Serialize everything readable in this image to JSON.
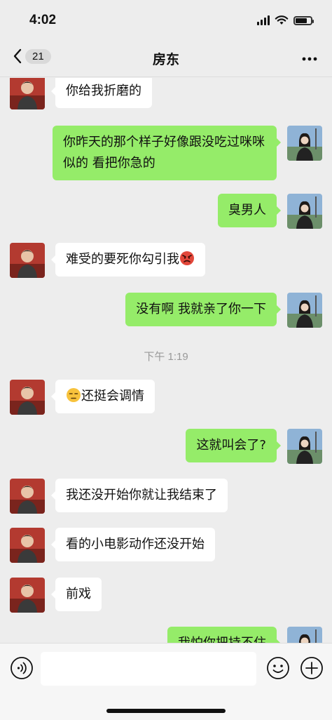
{
  "status_bar": {
    "time": "4:02"
  },
  "header": {
    "back_badge": "21",
    "title": "房东",
    "more_icon": "more-dots-icon"
  },
  "messages": [
    {
      "side": "left",
      "text": "你给我折磨的"
    },
    {
      "side": "right",
      "text": "你昨天的那个样子好像跟没吃过咪咪似的 看把你急的"
    },
    {
      "side": "right",
      "text": "臭男人"
    },
    {
      "side": "left",
      "text": "难受的要死你勾引我",
      "emoji": "angry-face"
    },
    {
      "side": "right",
      "text": "没有啊 我就亲了你一下"
    },
    {
      "side": "left",
      "text": "还挺会调情",
      "emoji_before": "unamused-face"
    },
    {
      "side": "right",
      "text": "这就叫会了?"
    },
    {
      "side": "left",
      "text": "我还没开始你就让我结束了"
    },
    {
      "side": "left",
      "text": "看的小电影动作还没开始"
    },
    {
      "side": "left",
      "text": "前戏"
    },
    {
      "side": "right",
      "text": "我怕你把持不住"
    }
  ],
  "timestamp": "下午 1:19",
  "input_bar": {
    "placeholder": "",
    "icons": [
      "voice-icon",
      "emoji-icon",
      "plus-icon"
    ]
  },
  "colors": {
    "background": "#ededed",
    "sent_bubble": "#95ec69",
    "received_bubble": "#ffffff"
  }
}
